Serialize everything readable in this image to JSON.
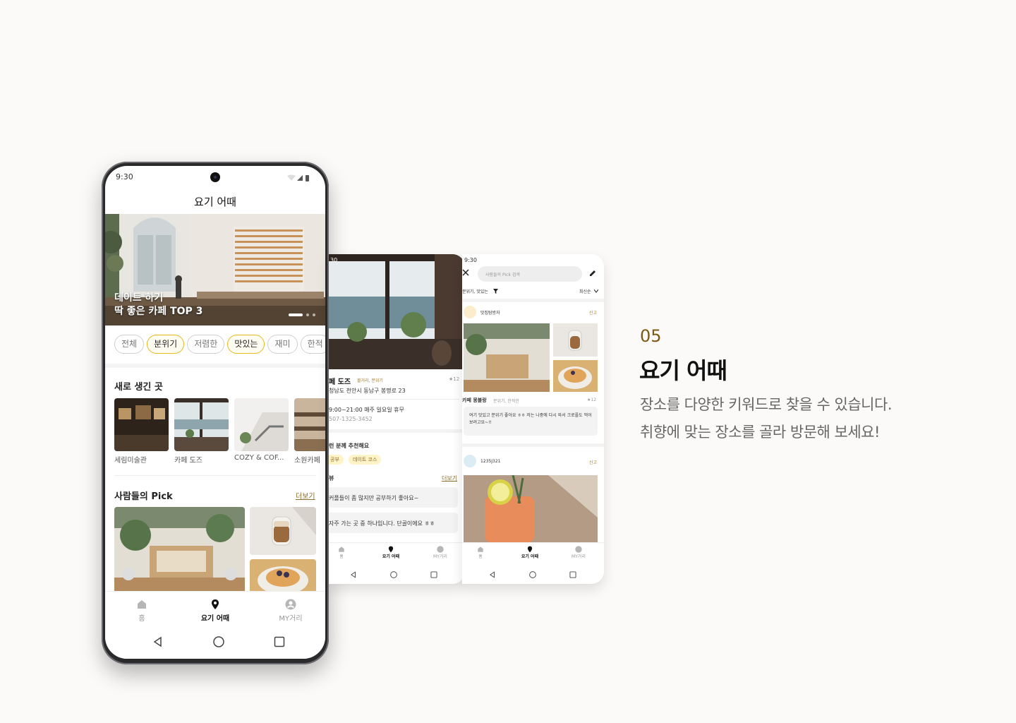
{
  "feature": {
    "number": "05",
    "title": "요기 어때",
    "desc_line1": "장소를 다양한 키워드로 찾을 수 있습니다.",
    "desc_line2": "취향에 맞는 장소를 골라 방문해 보세요!"
  },
  "main": {
    "status_time": "9:30",
    "title": "요기 어때",
    "hero_line1": "데이트 하기",
    "hero_line2": "딱 좋은 카페 TOP 3",
    "chips": [
      "전체",
      "분위기",
      "저렴한",
      "맛있는",
      "재미",
      "한적"
    ],
    "new_places_title": "새로 생긴 곳",
    "new_places": [
      "세림미술관",
      "카페 도즈",
      "COZY & COF...",
      "소원카페"
    ],
    "picks_title": "사람들의 Pick",
    "more": "더보기"
  },
  "nav": {
    "home": "홈",
    "where": "요기 어때",
    "my": "MY거리"
  },
  "detail": {
    "status_time": "30",
    "place_name": "페 도즈",
    "place_tags": "볼거리, 분위기",
    "rating": "★12",
    "address": "청남도 천안시 동남구 봉명로 23",
    "hours": "9:00~21:00 매주 일요일 휴무",
    "phone": "507-1325-3452",
    "recommend_title": "런 분께 추천해요",
    "recommend_tags": [
      "공부",
      "데이트 코스"
    ],
    "review_title": "뷰",
    "more": "더보기",
    "review1": "커플들이 좀 많지만 공부하기 좋아요~",
    "review2": "자주 가는 곳 중 하나입니다. 단골이에요 ㅎㅎ"
  },
  "feed": {
    "status_time": "9:30",
    "search_placeholder": "사람들의 Pick 검색",
    "filter": "분위기, 맛있는",
    "sort": "최신순",
    "post1_user": "맛집탐방자",
    "report": "신고",
    "post1_place": "카페 몽블랑",
    "post1_tags": "분위기, 한적한",
    "post1_rating": "★12",
    "post1_review": "여기 맛있고 분위기 좋아요 ㅎㅎ 저는 나중에 다시 와서 크로플도 먹어보려고요~!!",
    "post2_user": "1235J321"
  }
}
